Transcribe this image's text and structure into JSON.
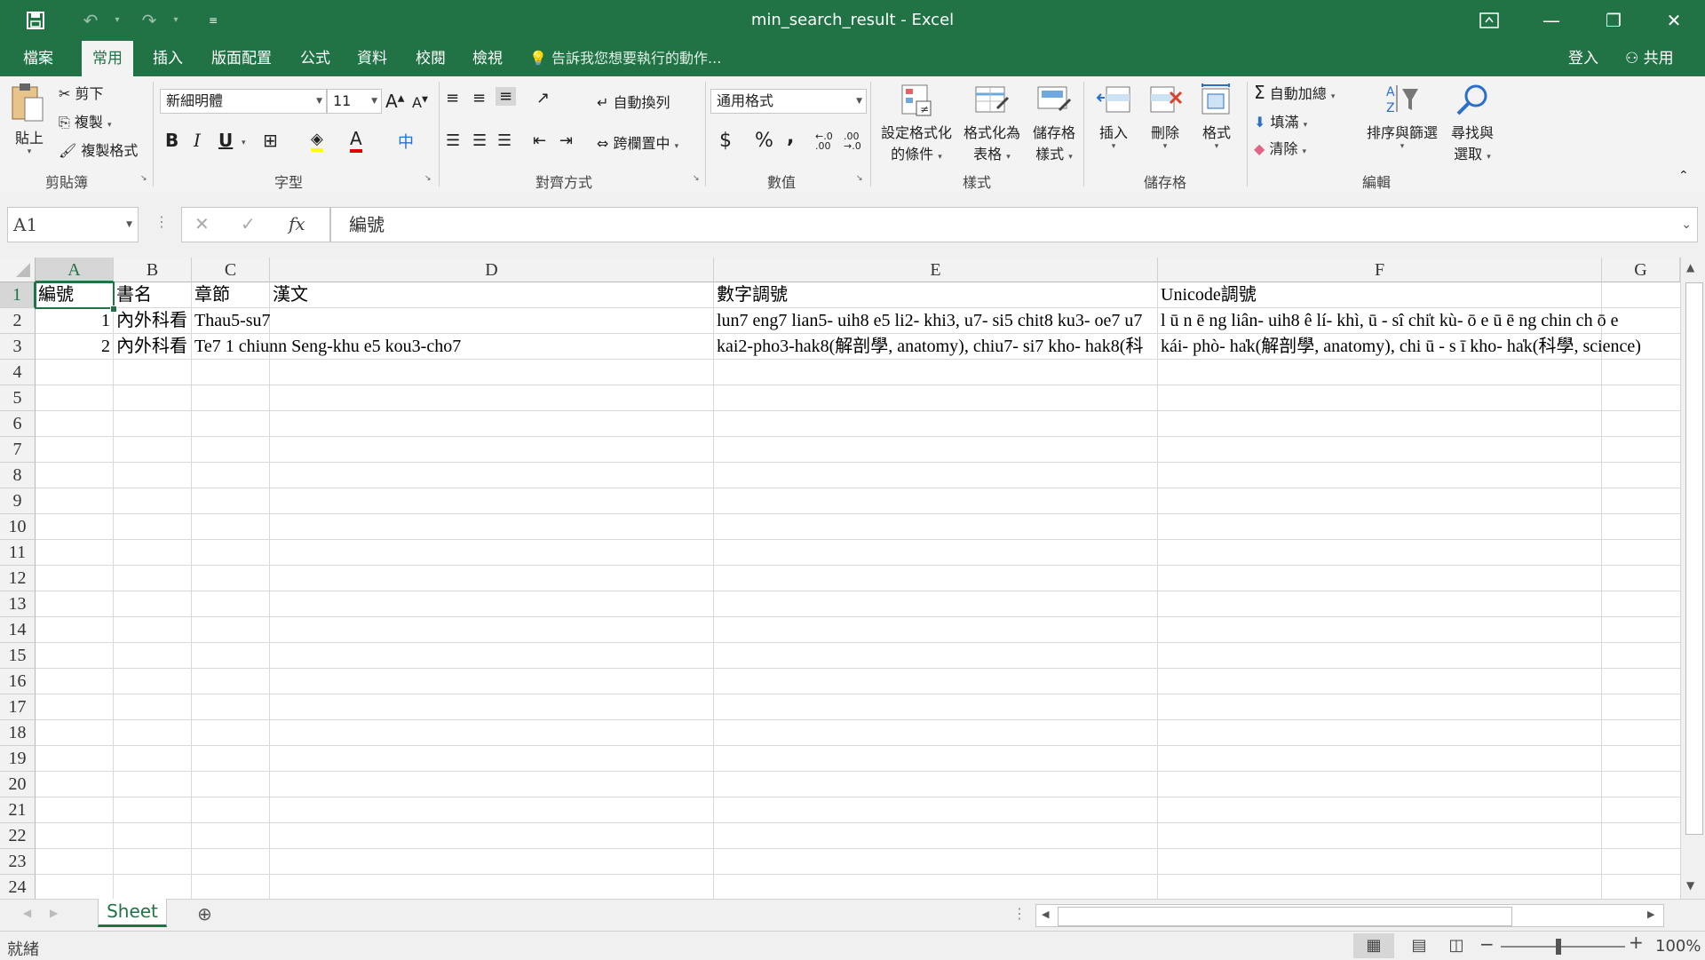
{
  "app": {
    "title": "min_search_result - Excel",
    "accent": "#217346"
  },
  "qat": {
    "save_icon": "save-icon",
    "undo_icon": "undo-icon",
    "redo_icon": "redo-icon",
    "customize_icon": "customize-qat-icon"
  },
  "window": {
    "restore_icon": "ribbon-display-icon",
    "min": "—",
    "max": "❐",
    "close": "✕"
  },
  "menu": {
    "tabs": [
      "檔案",
      "常用",
      "插入",
      "版面配置",
      "公式",
      "資料",
      "校閱",
      "檢視"
    ],
    "active": "常用",
    "tell_me": "告訴我您想要執行的動作...",
    "sign_in": "登入",
    "share": "共用"
  },
  "ribbon": {
    "clipboard": {
      "paste": "貼上",
      "cut": "剪下",
      "copy": "複製",
      "format_painter": "複製格式",
      "label": "剪貼簿"
    },
    "font": {
      "name": "新細明體",
      "size": "11",
      "bold": "B",
      "italic": "I",
      "underline": "U",
      "label": "字型"
    },
    "alignment": {
      "wrap": "自動換列",
      "merge": "跨欄置中",
      "label": "對齊方式"
    },
    "number": {
      "format": "通用格式",
      "currency": "$",
      "percent": "%",
      "comma": ",",
      "label": "數值"
    },
    "styles": {
      "conditional_1": "設定格式化",
      "conditional_2": "的條件",
      "table_1": "格式化為",
      "table_2": "表格",
      "cell_1": "儲存格",
      "cell_2": "樣式",
      "label": "樣式"
    },
    "cells": {
      "insert": "插入",
      "delete": "刪除",
      "format": "格式",
      "label": "儲存格"
    },
    "editing": {
      "autosum": "自動加總",
      "fill": "填滿",
      "clear": "清除",
      "sort_1": "排序與篩選",
      "find_1": "尋找與",
      "find_2": "選取",
      "label": "編輯"
    }
  },
  "formula_bar": {
    "name_box": "A1",
    "fx": "fx",
    "value": "編號"
  },
  "grid": {
    "columns": [
      "A",
      "B",
      "C",
      "D",
      "E",
      "F",
      "G"
    ],
    "rows": [
      "1",
      "2",
      "3",
      "4",
      "5",
      "6",
      "7",
      "8",
      "9",
      "10",
      "11",
      "12",
      "13",
      "14",
      "15",
      "16",
      "17",
      "18",
      "19",
      "20",
      "21",
      "22",
      "23",
      "24"
    ],
    "cells": {
      "A1": "編號",
      "B1": "書名",
      "C1": "章節",
      "D1": "漢文",
      "E1": "數字調號",
      "F1": "Unicode調號",
      "A2": "1",
      "B2": "內外科看",
      "C2": "Thau5-su7",
      "E2": "lun7 eng7 lian5- uih8 e5 li2- khi3, u7- si5 chit8 ku3- oe7 u7 ",
      "F2": "l ū n   ē ng liân- uih8 ê lí- khì,  ū - sî chi̍t kù-  ō e   ū   ē ng chin ch ō e",
      "A3": "2",
      "B3": "內外科看",
      "C3": "Te7 1 chiunn Seng-khu e5 kou3-cho7",
      "E3": "kai2-pho3-hak8(解剖學, anatomy), chiu7- si7 kho- hak8(科",
      "F3": "kái- phò- ha̍k(解剖學, anatomy), chi ū - s ī  kho- ha̍k(科學, science)"
    }
  },
  "sheets": {
    "active": "Sheet",
    "add_icon": "add-sheet-icon"
  },
  "status": {
    "ready": "就緒",
    "zoom": "100%"
  }
}
